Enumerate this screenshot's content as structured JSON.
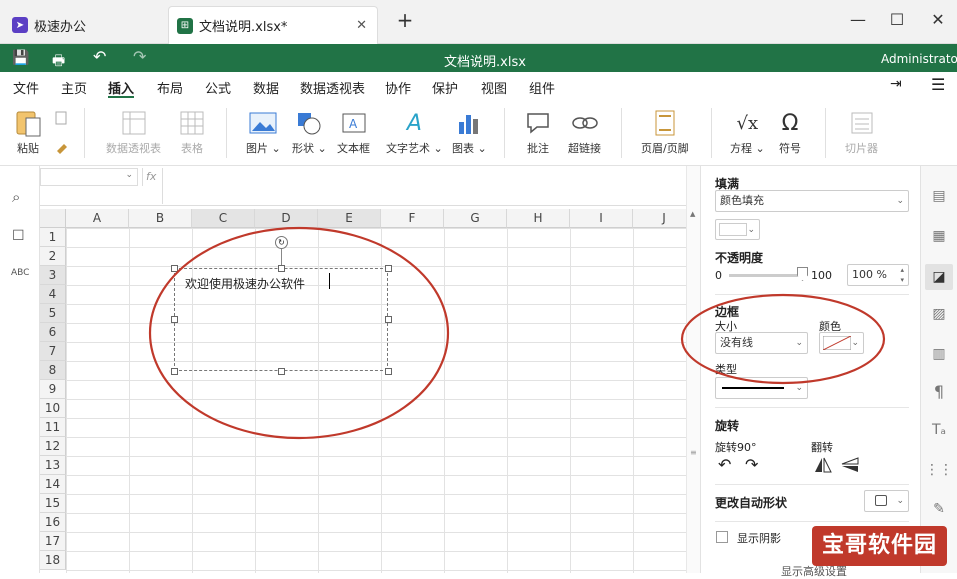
{
  "tabs": [
    {
      "label": "极速办公"
    },
    {
      "label": "文档说明.xlsx*"
    }
  ],
  "window": {
    "title": "文档说明.xlsx",
    "user": "Administrator"
  },
  "menu": [
    "文件",
    "主页",
    "插入",
    "布局",
    "公式",
    "数据",
    "数据透视表",
    "协作",
    "保护",
    "视图",
    "组件"
  ],
  "ribbon": {
    "paste": "粘贴",
    "pivot": "数据透视表",
    "table": "表格",
    "image": "图片",
    "shape": "形状",
    "textbox": "文本框",
    "wordart": "文字艺术",
    "chart": "图表",
    "comment": "批注",
    "hyperlink": "超链接",
    "headerfooter": "页眉/页脚",
    "equation": "方程",
    "symbol": "符号",
    "slicer": "切片器"
  },
  "sheet": {
    "columns": [
      "A",
      "B",
      "C",
      "D",
      "E",
      "F",
      "G",
      "H",
      "I",
      "J"
    ],
    "rows": [
      "1",
      "2",
      "3",
      "4",
      "5",
      "6",
      "7",
      "8",
      "9",
      "10",
      "11",
      "12",
      "13",
      "14",
      "15",
      "16",
      "17",
      "18"
    ],
    "textbox_text": "欢迎使用极速办公软件"
  },
  "formula": {
    "fx": "fx"
  },
  "panel": {
    "fill_title": "填满",
    "fill_type": "颜色填充",
    "opacity_title": "不透明度",
    "opacity_min": "0",
    "opacity_max": "100",
    "opacity_value": "100 %",
    "border_title": "边框",
    "size_label": "大小",
    "size_value": "没有线",
    "color_label": "颜色",
    "type_label": "类型",
    "rotate_title": "旋转",
    "rotate90": "旋转90°",
    "flip": "翻转",
    "change_shape": "更改自动形状",
    "shadow": "显示阴影",
    "advanced": "显示高级设置"
  },
  "watermark": "宝哥软件园",
  "colors": {
    "green": "#217346",
    "annotation": "#c0392b"
  }
}
